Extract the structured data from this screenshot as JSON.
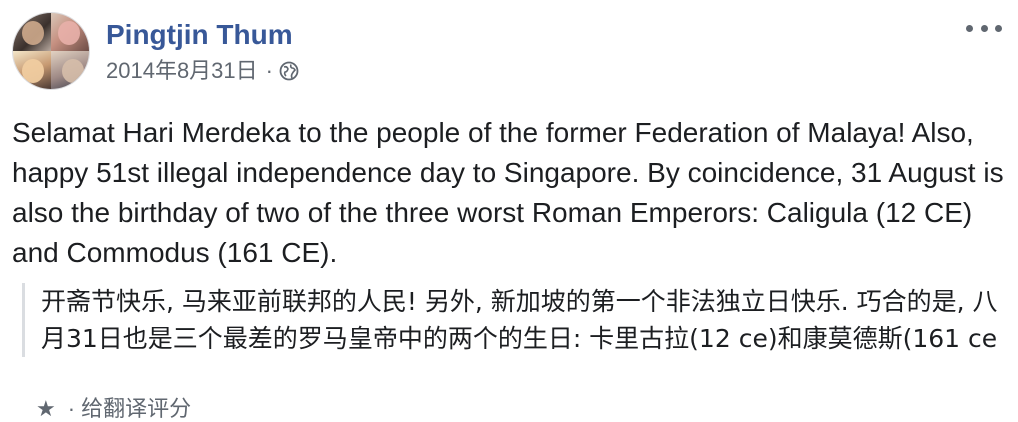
{
  "post": {
    "author": "Pingtjin Thum",
    "timestamp": "2014年8月31日",
    "separator": "·",
    "privacy_icon": "globe-icon",
    "more_icon": "more-options-icon",
    "body_text": "Selamat Hari Merdeka to the people of the former Federation of Malaya! Also, happy 51st illegal independence day to Singapore. By coincidence, 31 August is also the birthday of two of the three worst Roman Emperors: Caligula (12 CE) and Commodus (161 CE).",
    "translation_text": "开斋节快乐, 马来亚前联邦的人民! 另外, 新加坡的第一个非法独立日快乐. 巧合的是, 八月31日也是三个最差的罗马皇帝中的两个的生日: 卡里古拉(12 ce)和康莫德斯(161 ce",
    "translation_footer": {
      "icon": "star-icon",
      "icon_glyph": "★",
      "label": "· 给翻译评分"
    }
  },
  "colors": {
    "author_link": "#385898",
    "meta_text": "#606770",
    "body_text": "#1c1e21",
    "quote_border": "#dadde1"
  }
}
